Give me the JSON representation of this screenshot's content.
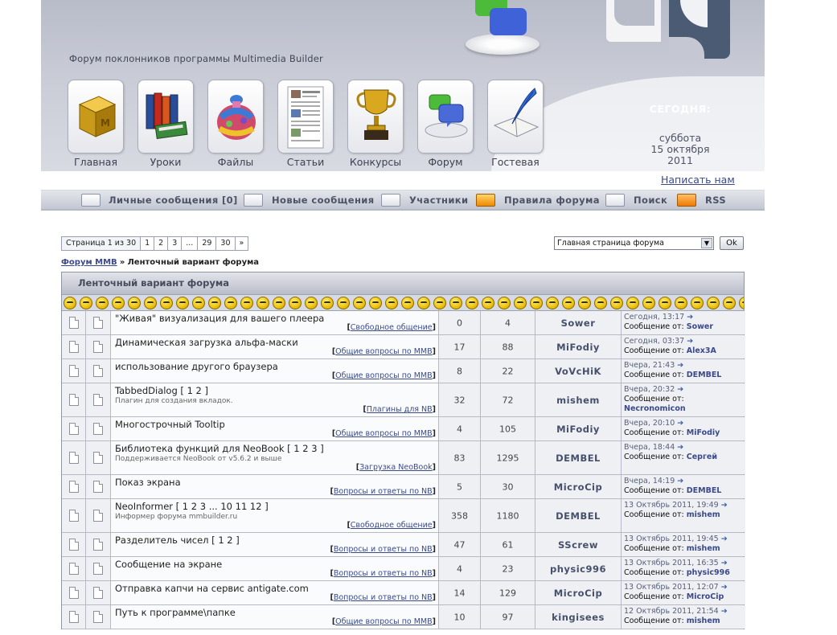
{
  "header": {
    "site_title": "Форум поклонников программы Multimedia Builder",
    "nav": [
      {
        "label": "Главная",
        "icon": "mmb-cube-icon"
      },
      {
        "label": "Уроки",
        "icon": "books-icon"
      },
      {
        "label": "Файлы",
        "icon": "bag-icon"
      },
      {
        "label": "Статьи",
        "icon": "article-icon"
      },
      {
        "label": "Конкурсы",
        "icon": "trophy-icon"
      },
      {
        "label": "Форум",
        "icon": "chat-bubbles-icon"
      },
      {
        "label": "Гостевая",
        "icon": "quill-book-icon"
      }
    ],
    "today_label": "СЕГОДНЯ:",
    "date_line1": "суббота",
    "date_line2": "15 октября",
    "date_line3": "2011",
    "write_us": "Написать нам"
  },
  "menu": [
    {
      "label": "Личные сообщения [0]",
      "icon": "envelope-icon"
    },
    {
      "label": "Новые сообщения",
      "icon": "new-posts-icon"
    },
    {
      "label": "Участники",
      "icon": "members-icon"
    },
    {
      "label": "Правила форума",
      "icon": "warning-icon"
    },
    {
      "label": "Поиск",
      "icon": "search-icon"
    },
    {
      "label": "RSS",
      "icon": "rss-icon"
    }
  ],
  "pager": {
    "label": "Страница 1 из 30",
    "pages": [
      "1",
      "2",
      "3",
      "...",
      "29",
      "30",
      "»"
    ]
  },
  "jump": {
    "selected": "Главная страница форума",
    "ok": "Ok"
  },
  "breadcrumb": {
    "home": "Форум MMB",
    "separator": "»",
    "current": "Ленточный вариант форума"
  },
  "table": {
    "title": "Ленточный вариант форума",
    "smiley_count": 44,
    "rows": [
      {
        "title": "\"Живая\" визуализация для вашего плеера",
        "desc": "",
        "forum": "Свободное общение",
        "replies": "0",
        "views": "4",
        "author": "Sower",
        "last_when": "Сегодня, 13:17",
        "last_by": "Sower"
      },
      {
        "title": "Динамическая загрузка альфа-маски",
        "desc": "",
        "forum": "Общие вопросы по MMB",
        "replies": "17",
        "views": "88",
        "author": "MiFodiy",
        "last_when": "Сегодня, 03:37",
        "last_by": "Alex3A"
      },
      {
        "title": "использование другого браузера",
        "desc": "",
        "forum": "Общие вопросы по MMB",
        "replies": "8",
        "views": "22",
        "author": "VoVcHiK",
        "last_when": "Вчера, 21:43",
        "last_by": "DEMBEL"
      },
      {
        "title": "TabbedDialog [ 1 2 ]",
        "desc": "Плагин для создания вкладок.",
        "forum": "Плагины для NB",
        "replies": "32",
        "views": "72",
        "author": "mishem",
        "last_when": "Вчера, 20:32",
        "last_by": "Necronomicon",
        "tall": true
      },
      {
        "title": "Многострочный Tooltip",
        "desc": "",
        "forum": "Общие вопросы по MMB",
        "replies": "4",
        "views": "105",
        "author": "MiFodiy",
        "last_when": "Вчера, 20:10",
        "last_by": "MiFodiy"
      },
      {
        "title": "Библиотека функций для NeoBook [ 1 2 3 ]",
        "desc": "Поддерживается NeoBook от v5.6.2 и выше",
        "forum": "Загрузка NeoBook",
        "replies": "83",
        "views": "1295",
        "author": "DEMBEL",
        "last_when": "Вчера, 18:44",
        "last_by": "Сергей",
        "tall": true
      },
      {
        "title": "Показ экрана",
        "desc": "",
        "forum": "Вопросы и ответы по NB",
        "replies": "5",
        "views": "30",
        "author": "MicroCip",
        "last_when": "Вчера, 14:19",
        "last_by": "DEMBEL"
      },
      {
        "title": "NeoInformer [ 1 2 3 ... 10 11 12 ]",
        "desc": "Информер форума mmbuilder.ru",
        "forum": "Свободное общение",
        "replies": "358",
        "views": "1180",
        "author": "DEMBEL",
        "last_when": "13 Октябрь 2011, 19:49",
        "last_by": "mishem",
        "tall": true
      },
      {
        "title": "Разделитель чисел [ 1 2 ]",
        "desc": "",
        "forum": "Вопросы и ответы по NB",
        "replies": "47",
        "views": "61",
        "author": "SScrew",
        "last_when": "13 Октябрь 2011, 19:45",
        "last_by": "mishem"
      },
      {
        "title": "Сообщение на экране",
        "desc": "",
        "forum": "Вопросы и ответы по NB",
        "replies": "4",
        "views": "23",
        "author": "physic996",
        "last_when": "13 Октябрь 2011, 16:35",
        "last_by": "physic996"
      },
      {
        "title": "Отправка капчи на сервис antigate.com",
        "desc": "",
        "forum": "Вопросы и ответы по NB",
        "replies": "14",
        "views": "129",
        "author": "MicroCip",
        "last_when": "13 Октябрь 2011, 12:07",
        "last_by": "MicroCip"
      },
      {
        "title": "Путь к программе\\папке",
        "desc": "",
        "forum": "Общие вопросы по MMB",
        "replies": "10",
        "views": "97",
        "author": "kingisees",
        "last_when": "12 Октябрь 2011, 21:54",
        "last_by": "mishem"
      }
    ],
    "forum_prefix": "[",
    "forum_suffix": "]",
    "last_by_prefix": "Сообщение от:",
    "last_arrow": "➔"
  },
  "colors": {
    "accent": "#3a4a8a",
    "header_bg": "#c9ccd6",
    "logo_blue": "#4a5b73"
  }
}
